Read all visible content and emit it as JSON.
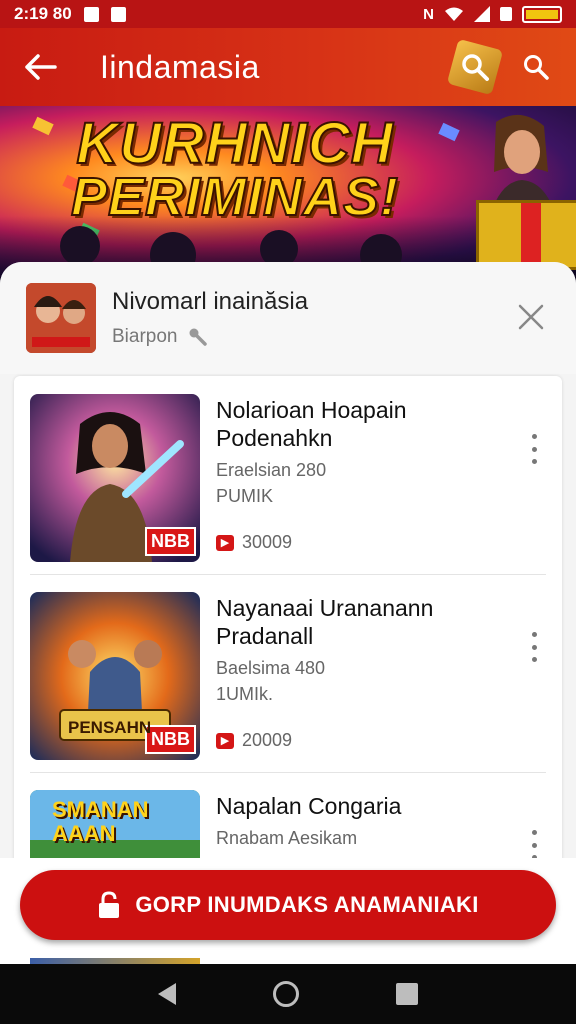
{
  "status_bar": {
    "time": "2:19 80"
  },
  "app_bar": {
    "title": "Iindamasia",
    "icons": {
      "back": "arrow-left-icon",
      "search": "search-icon",
      "search_alt": "search-icon"
    }
  },
  "banner": {
    "line1": "KURHNICH",
    "line2": "PERIMINAS!"
  },
  "sheet": {
    "name": "Nivomarl inainăsia",
    "subtitle": "Biarpon",
    "close_icon": "close-icon"
  },
  "items": [
    {
      "name": "Nolarioan Hoapain Podenahkn",
      "meta1": "Eraelsian 280",
      "meta2": "PUMIK",
      "price": "30009",
      "badge": "NBB"
    },
    {
      "name": "Nayanaai Urananann Pradanall",
      "meta1": "Baelsima 480",
      "meta2": "1UMIk.",
      "price": "20009",
      "badge": "NBB",
      "thumb_text": "PENSAHN"
    },
    {
      "name": "Napalan Congaria",
      "meta1": "Rnabam Aesikam",
      "meta2": "",
      "price": "",
      "thumb_text": "SMANAN AAAN"
    }
  ],
  "cta": {
    "label": "GORP INUMDAKS ANAMANIAKI",
    "icon": "lock-icon"
  },
  "nav": {
    "back": "nav-back-icon",
    "home": "nav-home-icon",
    "recent": "nav-recent-icon"
  },
  "colors": {
    "primary": "#cc1010",
    "app_bar": "#d73216",
    "text": "#111111"
  }
}
